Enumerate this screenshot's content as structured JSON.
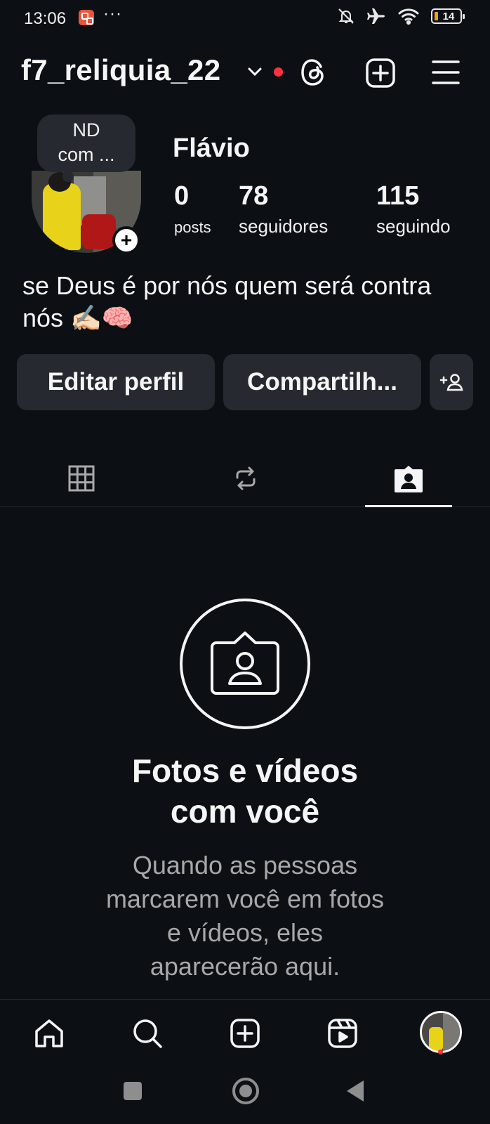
{
  "status_bar": {
    "time": "13:06",
    "overflow": "···",
    "battery_level": "14",
    "icons": [
      "notifications-muted-icon",
      "airplane-mode-icon",
      "wifi-icon",
      "battery-icon"
    ]
  },
  "header": {
    "username": "f7_reliquia_22",
    "icons": [
      "chevron-down-icon",
      "threads-icon",
      "create-icon",
      "menu-icon"
    ],
    "notification_dot_color": "#ff3040"
  },
  "profile": {
    "note_text": "ND\ncom ...",
    "display_name": "Flávio",
    "stats": {
      "posts_value": "0",
      "posts_label": "posts",
      "followers_value": "78",
      "followers_label": "seguidores",
      "following_value": "115",
      "following_label": "seguindo"
    },
    "bio": "se Deus é por nós quem será contra nós ✍🏻🧠"
  },
  "actions": {
    "edit_label": "Editar perfil",
    "share_label": "Compartilh..."
  },
  "tabs": {
    "items": [
      "grid-icon",
      "reposts-icon",
      "tagged-icon"
    ],
    "active": "tagged-icon"
  },
  "empty_state": {
    "title": "Fotos e vídeos com você",
    "description": "Quando as pessoas marcarem você em fotos e vídeos, eles aparecerão aqui."
  },
  "bottom_nav": {
    "items": [
      "home-icon",
      "search-icon",
      "create-icon",
      "reels-icon",
      "profile-avatar"
    ]
  },
  "colors": {
    "background": "#0c1014",
    "surface": "#262a30",
    "accent_red": "#ff3040",
    "muted_text": "#a8a8a8"
  }
}
